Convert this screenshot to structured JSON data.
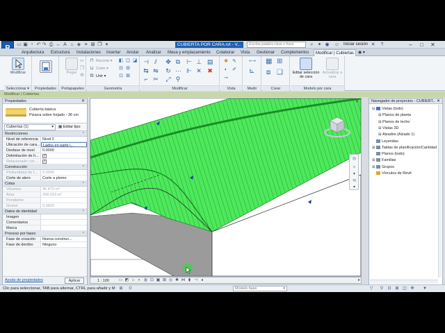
{
  "title_bar": {
    "app_logo": "R",
    "document_title": "CUBIERTA POR CARA.rvt - V...",
    "search_placeholder": "Escriba palabra clave o frase",
    "sign_in": "Iniciar sesión"
  },
  "ribbon_tabs": [
    {
      "label": "Arquitectura"
    },
    {
      "label": "Estructura"
    },
    {
      "label": "Instalaciones"
    },
    {
      "label": "Insertar"
    },
    {
      "label": "Anotar"
    },
    {
      "label": "Analizar"
    },
    {
      "label": "Masa y emplazamiento"
    },
    {
      "label": "Colaborar"
    },
    {
      "label": "Vista"
    },
    {
      "label": "Gestionar"
    },
    {
      "label": "Complementos"
    },
    {
      "label": "Modificar | Cubiertas",
      "active": true
    }
  ],
  "ribbon": {
    "select": {
      "button": "Modificar",
      "panel": "Seleccionar"
    },
    "properties": {
      "panel": "Propiedades"
    },
    "clipboard": {
      "button": "Pegar",
      "panel": "Portapapeles"
    },
    "geometry": {
      "cut": "Recorte",
      "cut2": "Corte",
      "join": "Unir",
      "panel": "Geometría"
    },
    "modify": {
      "panel": "Modificar"
    },
    "view": {
      "panel": "Vista"
    },
    "measure": {
      "panel": "Medir"
    },
    "create": {
      "panel": "Crear"
    },
    "face_model": {
      "edit_button": "Editar selección de cara",
      "update_button": "Actualizar a cara",
      "panel": "Modelo por cara"
    }
  },
  "context_bar": "Modificar | Cubiertas",
  "properties": {
    "header": "Propiedades",
    "type_name": "Cubierta básica",
    "type_subname": "Pizarra sobre forjado - 36 cm",
    "instance_selector": "Cubiertas (1)",
    "edit_type": "Editar tipo",
    "sections": [
      {
        "title": "Restricciones",
        "rows": [
          {
            "key": "Nivel de referencia",
            "value": "Nivel 2"
          },
          {
            "key": "Ubicación de cara...",
            "value": "Lados en parte i...",
            "editing": true
          },
          {
            "key": "Desfase de nivel",
            "value": "0.0000"
          },
          {
            "key": "Delimitación de h...",
            "value": "",
            "check": true
          },
          {
            "key": "Relacionado con ...",
            "value": "",
            "check": true,
            "dim": true
          }
        ]
      },
      {
        "title": "Construcción",
        "rows": [
          {
            "key": "Profundidad de l...",
            "value": "0.0000",
            "dim": true
          },
          {
            "key": "Corte de alero",
            "value": "Corte a plomo"
          }
        ]
      },
      {
        "title": "Cotas",
        "rows": [
          {
            "key": "Volumen",
            "value": "96.473 m³",
            "dim": true
          },
          {
            "key": "Área",
            "value": "268.033 m²",
            "dim": true
          },
          {
            "key": "Pendiente",
            "value": "",
            "dim": true
          },
          {
            "key": "Grosor",
            "value": "0.3600",
            "dim": true
          }
        ]
      },
      {
        "title": "Datos de identidad",
        "rows": [
          {
            "key": "Imagen",
            "value": ""
          },
          {
            "key": "Comentarios",
            "value": ""
          },
          {
            "key": "Marca",
            "value": ""
          }
        ]
      },
      {
        "title": "Proceso por fases",
        "rows": [
          {
            "key": "Fase de creación",
            "value": "Nueva construc..."
          },
          {
            "key": "Fase de derribo",
            "value": "Ninguno"
          }
        ]
      }
    ],
    "help_link": "Ayuda de propiedades",
    "apply_button": "Aplicar"
  },
  "viewport": {
    "scale": "1 : 100",
    "colors": {
      "roof_green": "#33e04a",
      "wall_gray": "#9c9c9c"
    }
  },
  "project_browser": {
    "header": "Navegador de proyectos - CUBIERT...",
    "nodes": [
      {
        "label": "Vistas (todo)",
        "level": 0,
        "toggle": "⊟",
        "icon": "views"
      },
      {
        "label": "Planos de planta",
        "level": 1,
        "toggle": "⊞"
      },
      {
        "label": "Planos de techo",
        "level": 1,
        "toggle": "⊞"
      },
      {
        "label": "Vistas 3D",
        "level": 1,
        "toggle": "⊞"
      },
      {
        "label": "Alzados (Alzado 1)",
        "level": 1,
        "toggle": "⊞"
      },
      {
        "label": "Leyendas",
        "level": 0,
        "toggle": "",
        "icon": "doc"
      },
      {
        "label": "Tablas de planificación/Cantidad",
        "level": 0,
        "toggle": "⊞",
        "icon": "doc"
      },
      {
        "label": "Planos (todo)",
        "level": 0,
        "toggle": "",
        "icon": "doc"
      },
      {
        "label": "Familias",
        "level": 0,
        "toggle": "⊞",
        "icon": "doc"
      },
      {
        "label": "Grupos",
        "level": 0,
        "toggle": "⊞",
        "icon": "doc"
      },
      {
        "label": "Vínculos de Revit",
        "level": 0,
        "toggle": "",
        "icon": "link"
      }
    ]
  },
  "status_bar": {
    "hint": "Clic para seleccionar, TAB para alternar, CTRL para añadir y M",
    "model": "Modelo base",
    "workset_count": ":0"
  }
}
